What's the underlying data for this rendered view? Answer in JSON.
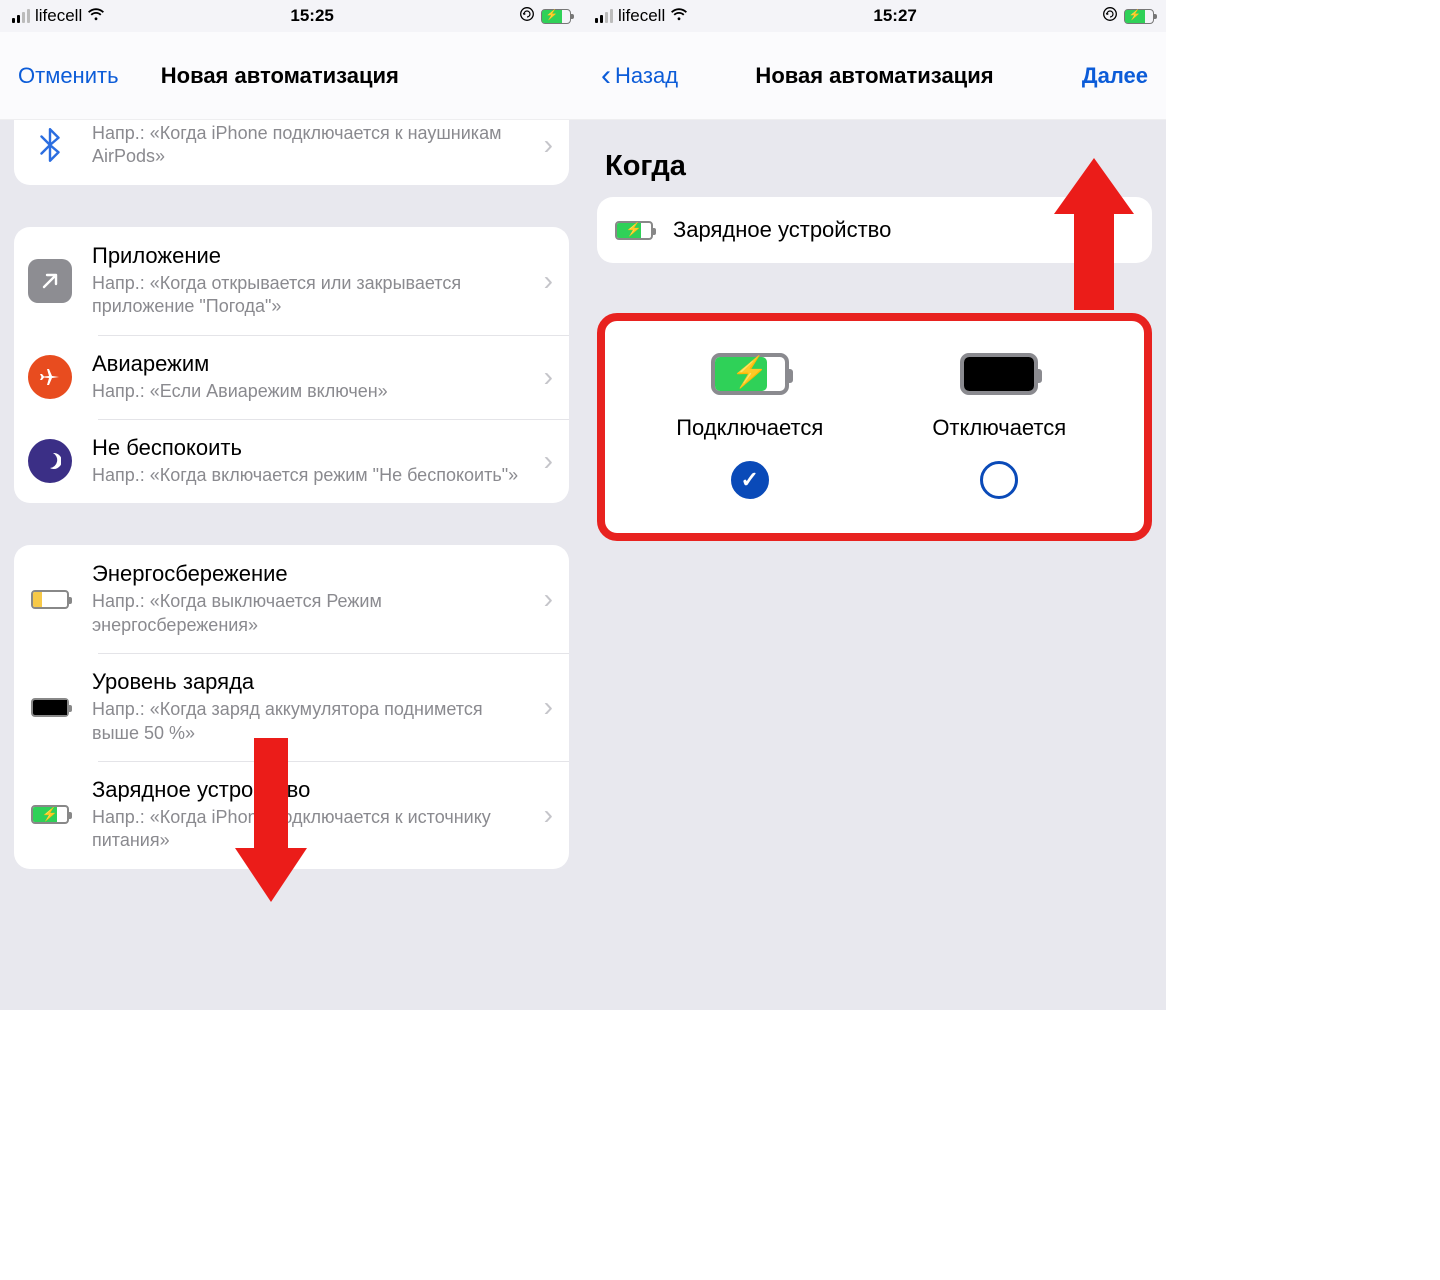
{
  "status": {
    "carrier": "lifecell",
    "time_left": "15:25",
    "time_right": "15:27"
  },
  "left": {
    "cancel": "Отменить",
    "title": "Новая автоматизация",
    "truncated_sub": "Напр.: «Когда iPhone подключается к наушникам AirPods»",
    "rows": {
      "app": {
        "title": "Приложение",
        "sub": "Напр.: «Когда открывается или закрывается приложение \"Погода\"»"
      },
      "airplane": {
        "title": "Авиарежим",
        "sub": "Напр.: «Если Авиарежим включен»"
      },
      "dnd": {
        "title": "Не беспокоить",
        "sub": "Напр.: «Когда включается режим \"Не беспокоить\"»"
      },
      "lowpower": {
        "title": "Энергосбережение",
        "sub": "Напр.: «Когда выключается Режим энергосбережения»"
      },
      "level": {
        "title": "Уровень заряда",
        "sub": "Напр.: «Когда заряд аккумулятора поднимется выше 50 %»"
      },
      "charger": {
        "title": "Зарядное устройство",
        "sub": "Напр.: «Когда iPhone подключается к источнику питания»"
      }
    }
  },
  "right": {
    "back": "Назад",
    "title": "Новая автоматизация",
    "next": "Далее",
    "when": "Когда",
    "trigger": "Зарядное устройство",
    "opt_connect": "Подключается",
    "opt_disconnect": "Отключается"
  }
}
